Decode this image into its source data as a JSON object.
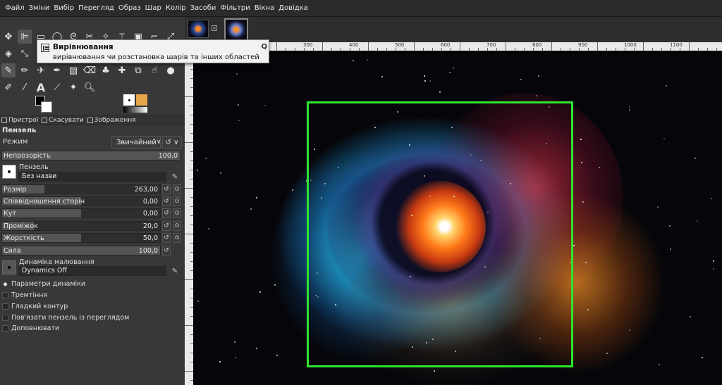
{
  "menu": [
    "Файл",
    "Зміни",
    "Вибір",
    "Перегляд",
    "Образ",
    "Шар",
    "Колір",
    "Засоби",
    "Фільтри",
    "Вікна",
    "Довідка"
  ],
  "tooltip": {
    "title": "Вирівнювання",
    "description": "вирівнювання чи розстановка шарів та інших областей",
    "help_key": "Q"
  },
  "dock_tabs": [
    {
      "label": "Пристрої",
      "icon": "devices-icon"
    },
    {
      "label": "Скасувати",
      "icon": "undo-history-icon"
    },
    {
      "label": "Зображення",
      "icon": "images-icon"
    }
  ],
  "tool_options": {
    "title": "Пензель",
    "mode_label": "Режим",
    "mode_value": "Звичайний",
    "opacity": {
      "label": "Непрозорість",
      "value": "100,0",
      "fraction": 1.0
    },
    "brush_label": "Пензель",
    "brush_name": "Без назви",
    "size": {
      "label": "Розмір",
      "value": "263,00",
      "fraction": 0.27
    },
    "aspect": {
      "label": "Співвідношення сторін",
      "value": "0,00",
      "fraction": 0.5
    },
    "angle": {
      "label": "Кут",
      "value": "0,00",
      "fraction": 0.5
    },
    "spacing": {
      "label": "Проміжок",
      "value": "20,0",
      "fraction": 0.2
    },
    "hardness": {
      "label": "Жорсткість",
      "value": "50,0",
      "fraction": 0.5
    },
    "force": {
      "label": "Сила",
      "value": "100,0",
      "fraction": 1.0
    },
    "dynamics_label": "Динаміка малювання",
    "dynamics_value": "Dynamics Off",
    "dynamics_options": "Параметри динаміки",
    "jitter": "Тремтіння",
    "smooth": "Гладкий контур",
    "lock_brush": "Пов'язати пензель із переглядом",
    "incremental": "Доповнювати"
  },
  "ruler_top": [
    "300",
    "400",
    "500",
    "600",
    "700",
    "800",
    "900",
    "1000",
    "1100"
  ],
  "colors": {
    "selection": "#2ee62e",
    "pattern": "#e7a649"
  }
}
